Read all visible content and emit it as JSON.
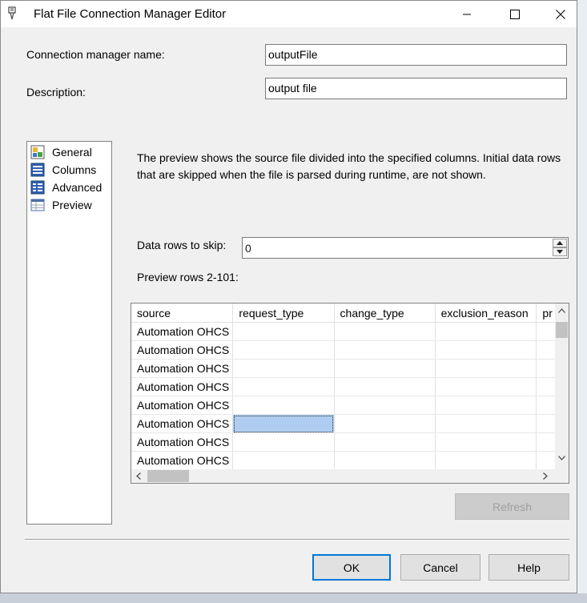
{
  "window": {
    "title": "Flat File Connection Manager Editor"
  },
  "form": {
    "name_label": "Connection manager name:",
    "name_value": "outputFile",
    "desc_label": "Description:",
    "desc_value": "output file"
  },
  "nav": {
    "items": [
      {
        "label": "General",
        "icon": "general-icon"
      },
      {
        "label": "Columns",
        "icon": "columns-icon"
      },
      {
        "label": "Advanced",
        "icon": "advanced-icon"
      },
      {
        "label": "Preview",
        "icon": "preview-icon",
        "selected": true
      }
    ]
  },
  "preview": {
    "info": "The preview shows the source file divided into the specified columns. Initial data rows that are skipped when the file is parsed during runtime, are not shown.",
    "skip_label": "Data rows to skip:",
    "skip_value": "0",
    "rows_label": "Preview rows 2-101:",
    "columns": [
      "source",
      "request_type",
      "change_type",
      "exclusion_reason",
      "pr"
    ],
    "rows": [
      [
        "Automation OHCS",
        "",
        "",
        "",
        ""
      ],
      [
        "Automation OHCS",
        "",
        "",
        "",
        ""
      ],
      [
        "Automation OHCS",
        "",
        "",
        "",
        ""
      ],
      [
        "Automation OHCS",
        "",
        "",
        "",
        ""
      ],
      [
        "Automation OHCS",
        "",
        "",
        "",
        ""
      ],
      [
        "Automation OHCS",
        "",
        "",
        "",
        ""
      ],
      [
        "Automation OHCS",
        "",
        "",
        "",
        ""
      ],
      [
        "Automation OHCS",
        "",
        "",
        "",
        ""
      ]
    ],
    "refresh_label": "Refresh"
  },
  "buttons": {
    "ok": "OK",
    "cancel": "Cancel",
    "help": "Help"
  },
  "colors": {
    "selection": "#aecdf0",
    "default_border": "#0078d7"
  }
}
